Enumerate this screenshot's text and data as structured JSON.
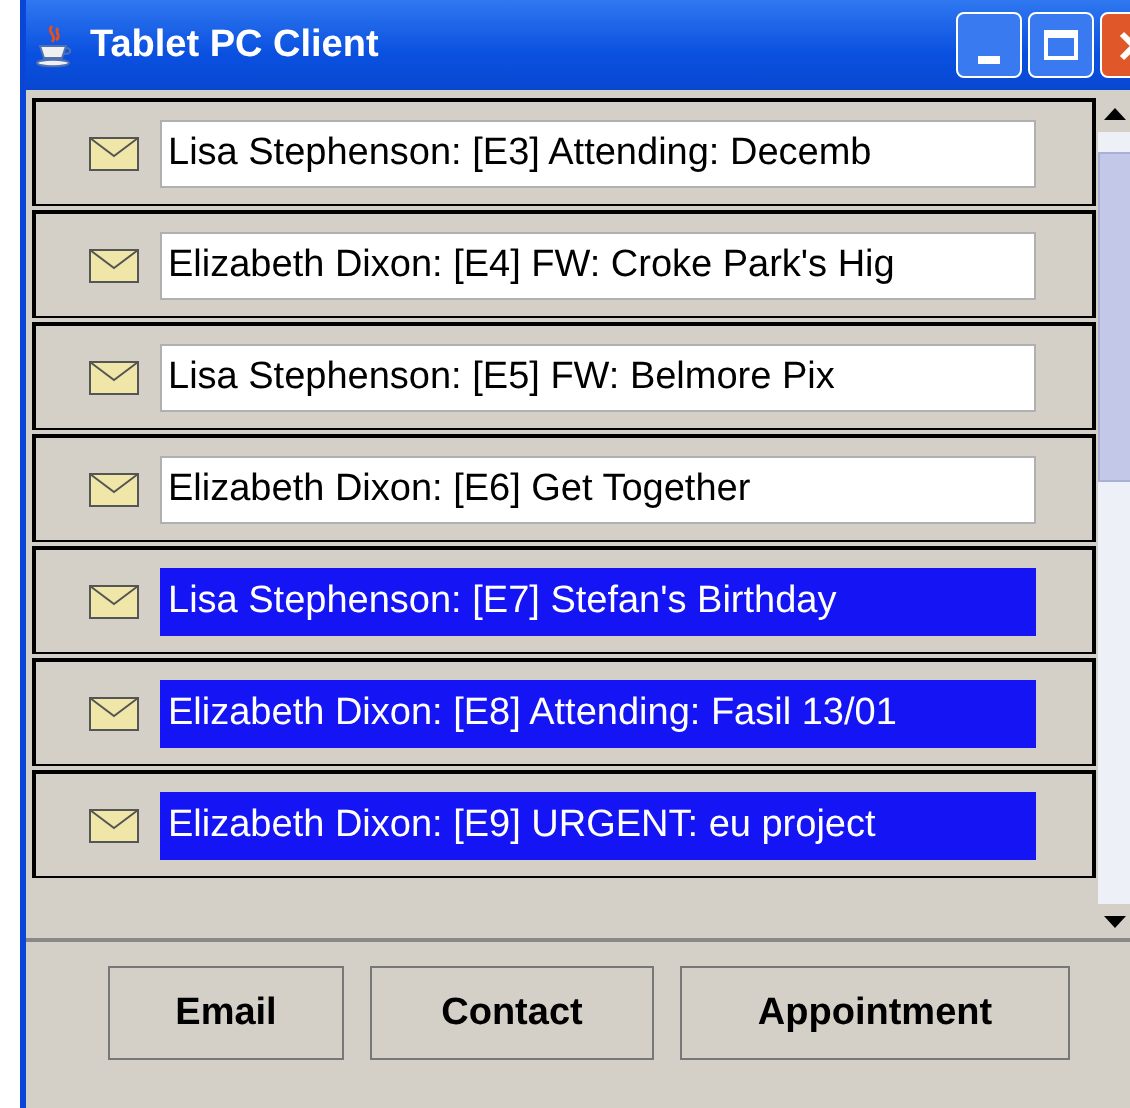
{
  "window": {
    "title": "Tablet PC Client"
  },
  "messages": [
    {
      "text": "Lisa Stephenson: [E3] Attending: Decemb",
      "selected": false
    },
    {
      "text": "Elizabeth Dixon: [E4] FW: Croke Park's Hig",
      "selected": false
    },
    {
      "text": "Lisa Stephenson: [E5] FW: Belmore Pix",
      "selected": false
    },
    {
      "text": "Elizabeth Dixon: [E6] Get Together",
      "selected": false
    },
    {
      "text": "Lisa Stephenson: [E7] Stefan's Birthday",
      "selected": true
    },
    {
      "text": "Elizabeth Dixon: [E8] Attending: Fasil 13/01",
      "selected": true
    },
    {
      "text": "Elizabeth Dixon: [E9] URGENT: eu project",
      "selected": true
    }
  ],
  "buttons": [
    "Email",
    "Contact",
    "Appointment"
  ]
}
